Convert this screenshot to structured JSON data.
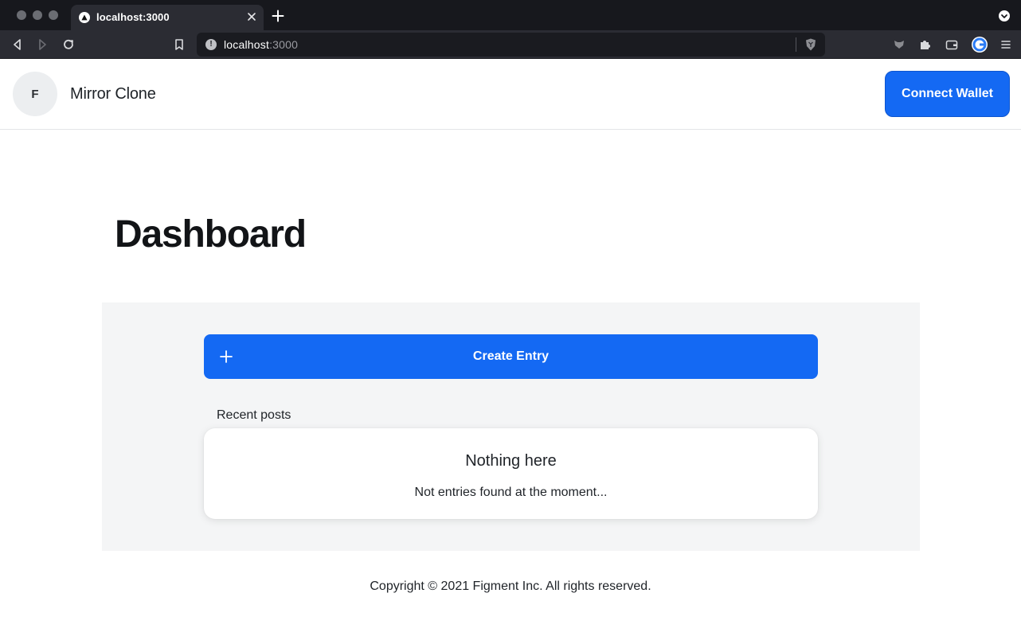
{
  "browser": {
    "tab_title": "localhost:3000",
    "url_host": "localhost",
    "url_port": ":3000"
  },
  "header": {
    "avatar_initial": "F",
    "site_title": "Mirror Clone",
    "connect_label": "Connect Wallet"
  },
  "main": {
    "page_title": "Dashboard",
    "create_label": "Create Entry",
    "recent_label": "Recent posts",
    "empty_title": "Nothing here",
    "empty_text": "Not entries found at the moment..."
  },
  "footer": {
    "copyright": "Copyright © 2021 Figment Inc. All rights reserved."
  },
  "colors": {
    "accent": "#1469f3",
    "chrome_dark": "#17181d",
    "panel_bg": "#f4f5f6"
  }
}
